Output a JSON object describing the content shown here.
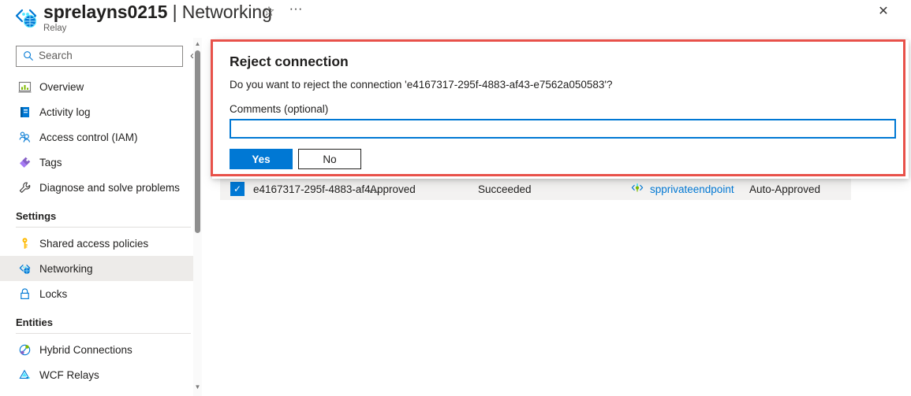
{
  "header": {
    "resource_icon": "relay-icon",
    "title": "sprelayns0215",
    "separator": "|",
    "page": "Networking",
    "subtitle": "Relay",
    "favorite_icon": "star-icon",
    "more_icon": "ellipsis-icon",
    "close_icon": "close-icon"
  },
  "sidebar": {
    "search": {
      "placeholder": "Search",
      "icon": "search-icon",
      "value": ""
    },
    "collapse_icon": "«",
    "items": [
      {
        "label": "Overview",
        "icon": "overview-icon",
        "selected": false
      },
      {
        "label": "Activity log",
        "icon": "activity-log-icon",
        "selected": false
      },
      {
        "label": "Access control (IAM)",
        "icon": "access-control-icon",
        "selected": false
      },
      {
        "label": "Tags",
        "icon": "tags-icon",
        "selected": false
      },
      {
        "label": "Diagnose and solve problems",
        "icon": "wrench-icon",
        "selected": false
      }
    ],
    "groups": [
      {
        "heading": "Settings",
        "items": [
          {
            "label": "Shared access policies",
            "icon": "key-icon",
            "selected": false
          },
          {
            "label": "Networking",
            "icon": "networking-icon",
            "selected": true
          },
          {
            "label": "Locks",
            "icon": "lock-icon",
            "selected": false
          }
        ]
      },
      {
        "heading": "Entities",
        "items": [
          {
            "label": "Hybrid Connections",
            "icon": "hybrid-connections-icon",
            "selected": false
          },
          {
            "label": "WCF Relays",
            "icon": "wcf-relays-icon",
            "selected": false
          }
        ]
      }
    ]
  },
  "dialog": {
    "title": "Reject connection",
    "message": "Do you want to reject the connection 'e4167317-295f-4883-af43-e7562a050583'?",
    "comments_label": "Comments (optional)",
    "comments_value": "",
    "comments_placeholder": "",
    "yes_label": "Yes",
    "no_label": "No",
    "highlight_color": "#e8514a",
    "accent_color": "#0078d4"
  },
  "connection_row": {
    "checked": true,
    "check_glyph": "✓",
    "name": "e4167317-295f-4883-af4...",
    "connection_state": "Approved",
    "provisioning_state": "Succeeded",
    "private_endpoint_icon": "private-endpoint-icon",
    "private_endpoint": "spprivateendpoint",
    "description": "Auto-Approved"
  }
}
